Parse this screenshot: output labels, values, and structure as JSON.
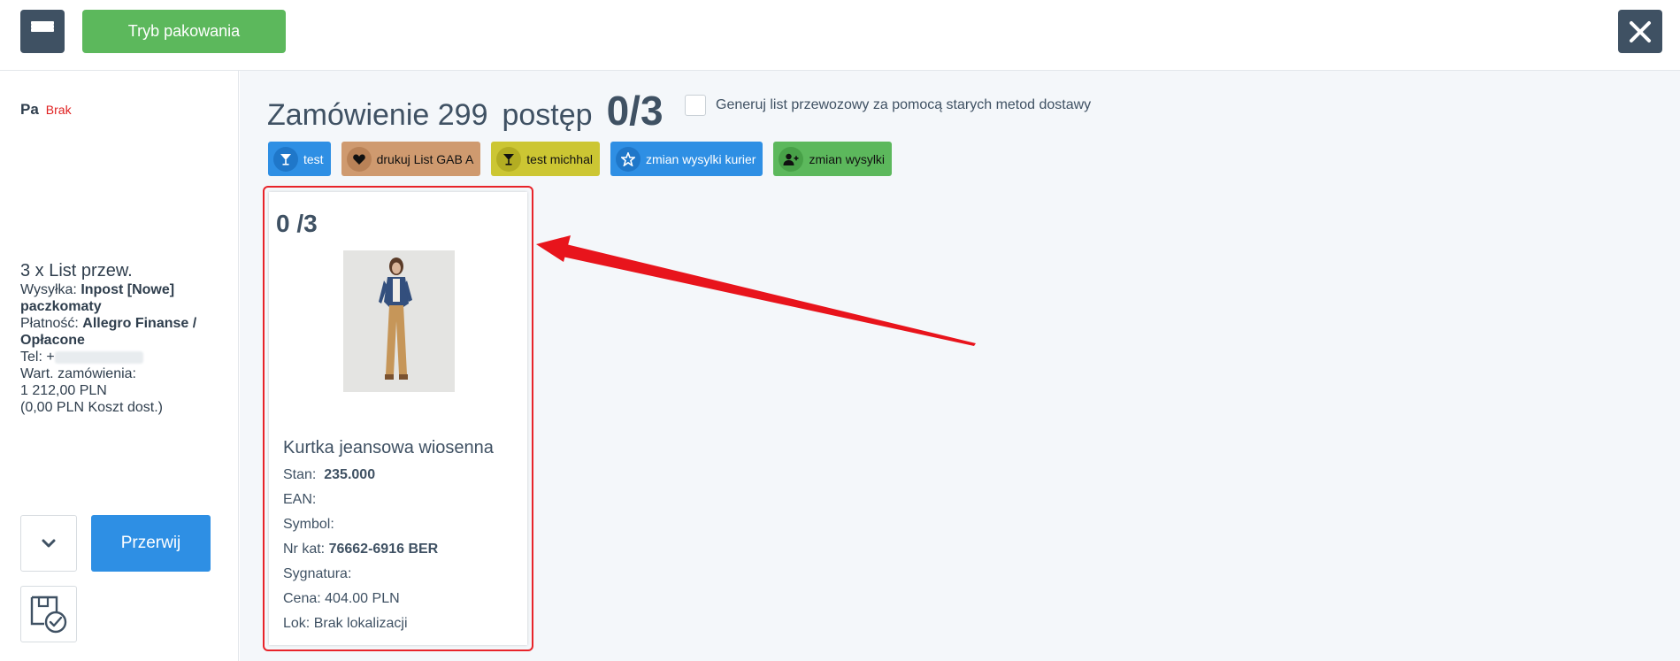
{
  "header": {
    "pack_mode_label": "Tryb pakowania"
  },
  "sidebar": {
    "pa_label": "Pa",
    "pa_status": "Brak",
    "summary": "3 x List przew.",
    "shipping_label": "Wysyłka:",
    "shipping_value": "Inpost [Nowe] paczkomaty",
    "payment_label": "Płatność:",
    "payment_value": "Allegro Finanse / Opłacone",
    "phone_label": "Tel: +",
    "order_value_label": "Wart. zamówienia:",
    "order_value": "1 212,00 PLN",
    "shipping_cost": "(0,00 PLN Koszt dost.)",
    "interrupt_label": "Przerwij"
  },
  "main": {
    "order_label": "Zamówienie 299",
    "progress_label": "postęp",
    "progress_value": "0/3",
    "generate_label": "Generuj list przewozowy za pomocą starych metod dostawy",
    "actions": [
      {
        "label": "test",
        "icon": "cocktail-icon"
      },
      {
        "label": "drukuj List GAB A",
        "icon": "heart-icon"
      },
      {
        "label": "test michhal",
        "icon": "cocktail-icon"
      },
      {
        "label": "zmian wysylki kurier",
        "icon": "star-icon"
      },
      {
        "label": "zmian wysylki",
        "icon": "user-plus-icon"
      }
    ]
  },
  "product": {
    "count": "0 /3",
    "name": "Kurtka jeansowa wiosenna",
    "stock_label": "Stan:",
    "stock_value": "235.000",
    "ean_label": "EAN:",
    "symbol_label": "Symbol:",
    "catalog_label": "Nr kat:",
    "catalog_value": "76662-6916 BER",
    "signature_label": "Sygnatura:",
    "price": "Cena: 404.00 PLN",
    "location": "Lok: Brak lokalizacji"
  },
  "colors": {
    "accent_green": "#5cb85c",
    "accent_blue": "#2e8fe4",
    "dark_button": "#3f5163",
    "highlight_red": "#e8242a"
  }
}
